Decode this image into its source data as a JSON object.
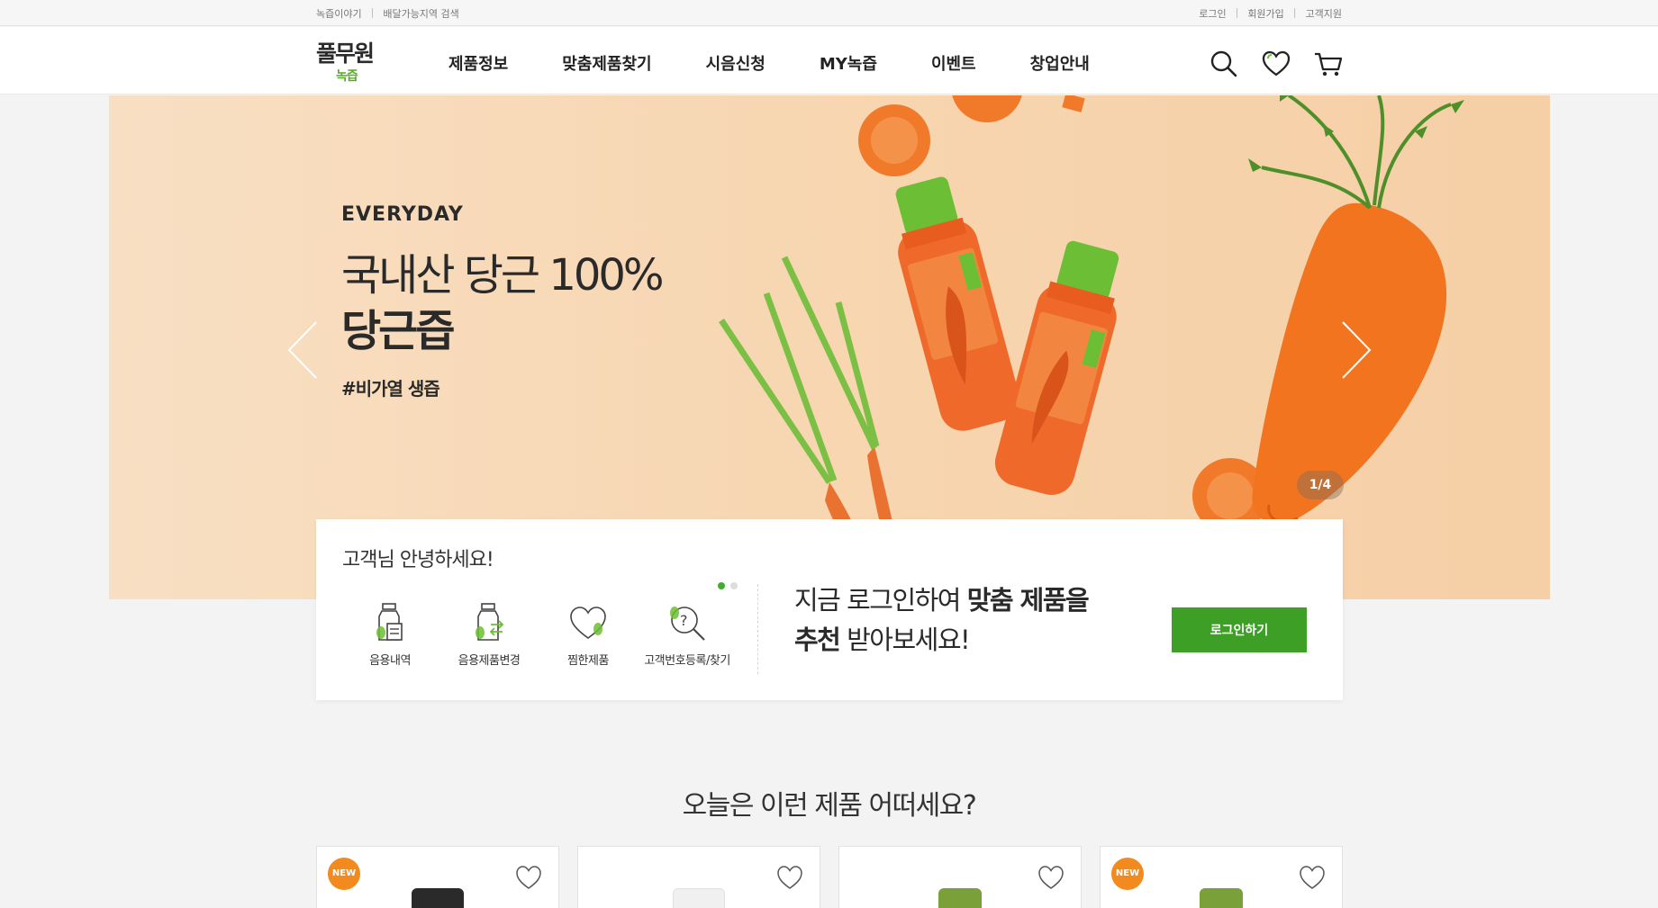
{
  "util": {
    "left_links": [
      "녹즙이야기",
      "배달가능지역 검색"
    ],
    "right_links": [
      "로그인",
      "회원가입",
      "고객지원"
    ]
  },
  "header": {
    "logo_main": "풀무원",
    "logo_sub": "녹즙",
    "nav": [
      "제품정보",
      "맞춤제품찾기",
      "시음신청",
      "MY녹즙",
      "이벤트",
      "창업안내"
    ],
    "icons": [
      "search-icon",
      "heart-icon",
      "cart-icon"
    ]
  },
  "hero": {
    "eyebrow": "EVERYDAY",
    "title1": "국내산 당근 100%",
    "title2": "당근즙",
    "tag": "#비가열 생즙",
    "counter": "1/4",
    "colors": {
      "bg": "#f7d9b8",
      "carrot": "#f07a2a",
      "cap": "#6cbf34"
    }
  },
  "card": {
    "greeting": "고객님 안녕하세요!",
    "quick_links": [
      "음용내역",
      "음용제품변경",
      "찜한제품",
      "고객번호등록/찾기"
    ],
    "cta_line1_a": "지금 로그인하여 ",
    "cta_line1_b": "맞춤 제품을",
    "cta_line2_a": "추천",
    "cta_line2_b": " 받아보세요!",
    "login_button": "로그인하기",
    "accent": "#3d9f26"
  },
  "section": {
    "title": "오늘은 이런 제품 어떠세요?",
    "products": [
      {
        "badge": "NEW",
        "cap_color": "#2a2a2a"
      },
      {
        "badge": "",
        "cap_color": "#f4f4f4"
      },
      {
        "badge": "",
        "cap_color": "#7aa03a"
      },
      {
        "badge": "NEW",
        "cap_color": "#7aa03a"
      }
    ]
  }
}
